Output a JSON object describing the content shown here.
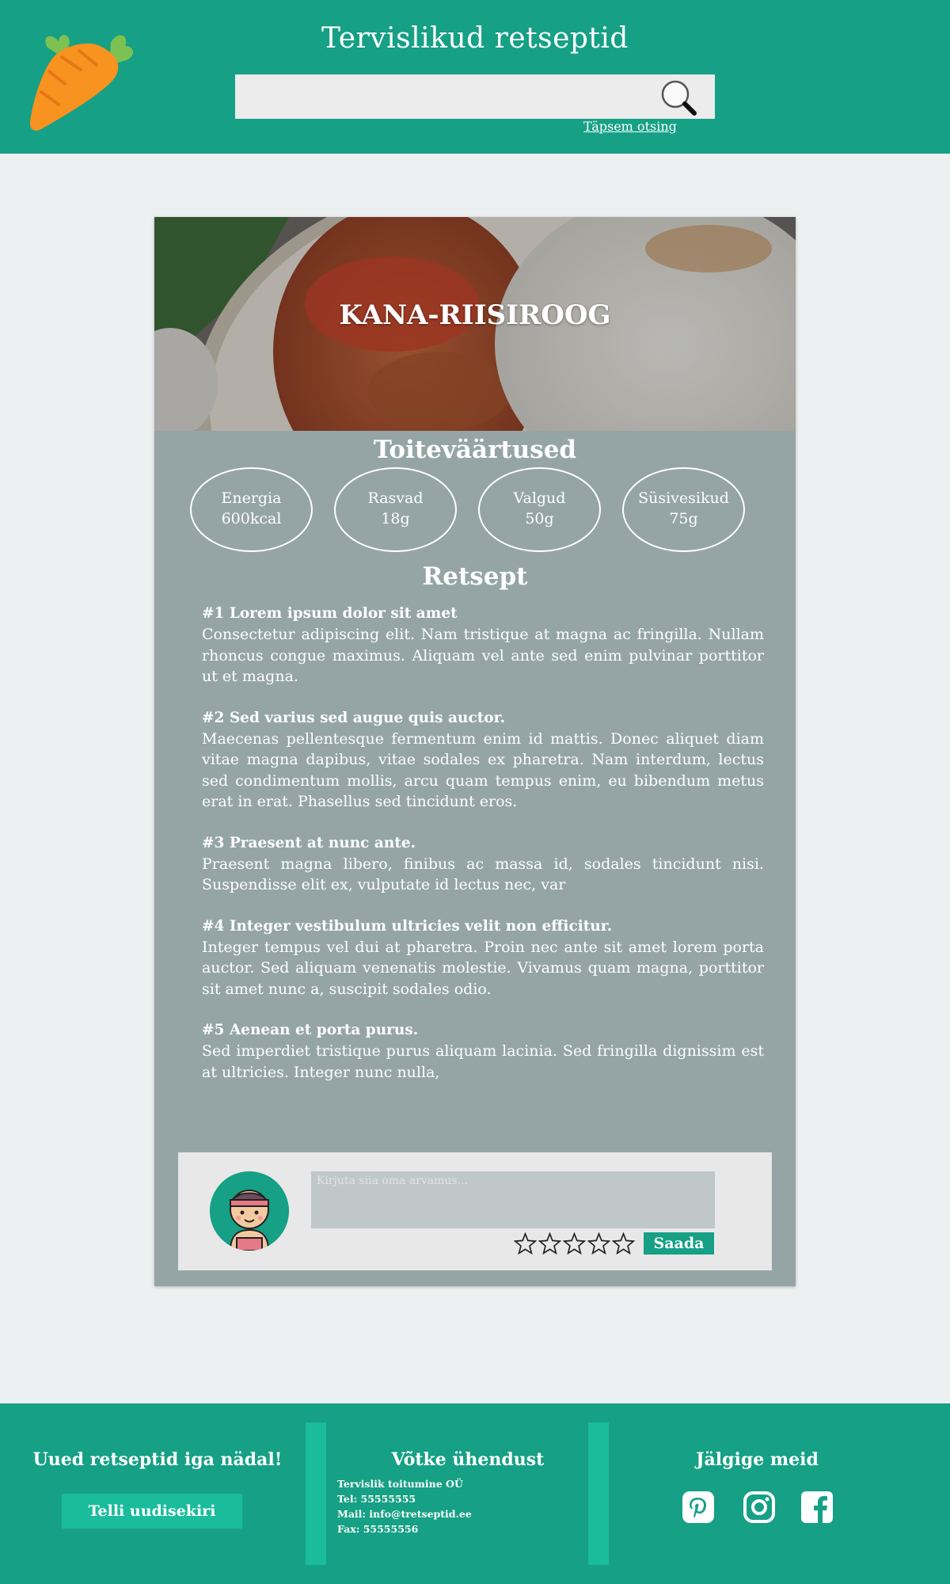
{
  "header": {
    "title": "Tervislikud retseptid",
    "search_placeholder": "",
    "advanced_search_label": "Täpsem otsing"
  },
  "recipe": {
    "title": "KANA-RIISIROOG",
    "nutrition_title": "Toiteväärtused",
    "nutrients": [
      {
        "label": "Energia",
        "value": "600kcal"
      },
      {
        "label": "Rasvad",
        "value": "18g"
      },
      {
        "label": "Valgud",
        "value": "50g"
      },
      {
        "label": "Süsivesikud",
        "value": "75g"
      }
    ],
    "recipe_title": "Retsept",
    "steps": [
      {
        "title": "#1 Lorem ipsum dolor sit amet",
        "text": "Consectetur adipiscing elit. Nam tristique at magna ac fringilla. Nullam rhoncus congue maximus. Aliquam vel ante sed enim pulvinar porttitor ut et magna."
      },
      {
        "title": "#2 Sed varius sed augue quis auctor.",
        "text": "Maecenas pellentesque fermentum enim id mattis. Donec aliquet diam vitae magna dapibus, vitae sodales ex pharetra. Nam interdum, lectus sed condimentum mollis, arcu quam tempus enim, eu bibendum metus erat in erat. Phasellus sed tincidunt eros."
      },
      {
        "title": "#3 Praesent at nunc ante.",
        "text": "Praesent magna libero, finibus ac massa id, sodales tincidunt nisi. Suspendisse elit ex, vulputate id lectus nec, var"
      },
      {
        "title": "#4 Integer vestibulum ultricies velit non efficitur.",
        "text": "Integer tempus vel dui at pharetra. Proin nec ante sit amet lorem porta auctor. Sed aliquam venenatis molestie. Vivamus quam magna, porttitor sit amet nunc a, suscipit sodales odio."
      },
      {
        "title": "#5 Aenean et porta purus.",
        "text": "Sed imperdiet tristique purus aliquam lacinia. Sed fringilla dignissim est at ultricies. Integer nunc nulla,"
      }
    ]
  },
  "comment": {
    "placeholder": "Kirjuta siia oma arvamus...",
    "rating": 0,
    "rating_max": 5,
    "send_label": "Saada"
  },
  "footer": {
    "newsletter_title": "Uued retseptid iga nädal!",
    "newsletter_button": "Telli uudisekiri",
    "contact_title": "Võtke ühendust",
    "contact_lines": [
      "Tervislik toitumine OÜ",
      "Tel: 55555555",
      "Mail: info@tretseptid.ee",
      "Fax: 55555556"
    ],
    "follow_title": "Jälgige meid",
    "social_icons": [
      "pinterest-icon",
      "instagram-icon",
      "facebook-icon"
    ]
  },
  "colors": {
    "primary": "#16a085",
    "accent": "#1abc9c",
    "card": "#95a5a6",
    "background": "#ecf0f1"
  }
}
